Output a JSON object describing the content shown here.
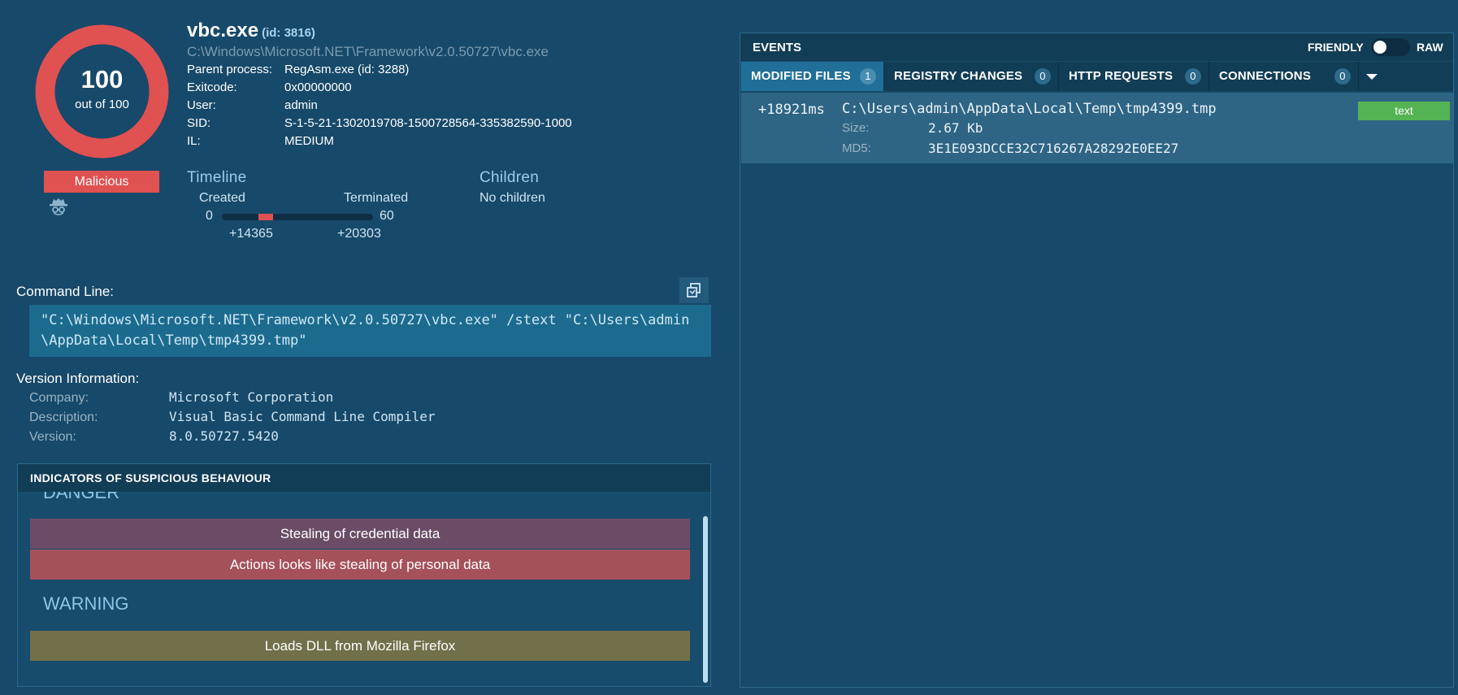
{
  "process": {
    "name": "vbc.exe",
    "id_label": "(id: 3816)",
    "path": "C:\\Windows\\Microsoft.NET\\Framework\\v2.0.50727\\vbc.exe",
    "fields": {
      "parent_label": "Parent process:",
      "parent_value": "RegAsm.exe (id: 3288)",
      "exit_label": "Exitcode:",
      "exit_value": "0x00000000",
      "user_label": "User:",
      "user_value": "admin",
      "sid_label": "SID:",
      "sid_value": "S-1-5-21-1302019708-1500728564-335382590-1000",
      "il_label": "IL:",
      "il_value": "MEDIUM"
    }
  },
  "score": {
    "value": "100",
    "subtitle": "out of 100",
    "fraction": 1.0,
    "verdict": "Malicious",
    "icon": "spy-icon",
    "color": "#e05152"
  },
  "timeline": {
    "title": "Timeline",
    "created_label": "Created",
    "terminated_label": "Terminated",
    "min": "0",
    "max": "60",
    "start": "+14365",
    "end": "+20303",
    "start_seconds": 14.365,
    "end_seconds": 20.303,
    "range_seconds": 60
  },
  "children": {
    "title": "Children",
    "value": "No children"
  },
  "command_line": {
    "label": "Command Line:",
    "text": "\"C:\\Windows\\Microsoft.NET\\Framework\\v2.0.50727\\vbc.exe\" /stext \"C:\\Users\\admin\\AppData\\Local\\Temp\\tmp4399.tmp\"",
    "copy_icon": "copy-icon"
  },
  "version_info": {
    "label": "Version Information:",
    "company_label": "Company:",
    "company_value": "Microsoft Corporation",
    "description_label": "Description:",
    "description_value": "Visual Basic Command Line Compiler",
    "version_label": "Version:",
    "version_value": "8.0.50727.5420"
  },
  "indicators": {
    "header": "INDICATORS OF SUSPICIOUS BEHAVIOUR",
    "danger_label": "DANGER",
    "danger_items": [
      "Stealing of credential data",
      "Actions looks like stealing of personal data"
    ],
    "warning_label": "WARNING",
    "warning_items": [
      "Loads DLL from Mozilla Firefox"
    ]
  },
  "events": {
    "title": "EVENTS",
    "friendly_label": "FRIENDLY",
    "raw_label": "RAW",
    "tabs": [
      {
        "label": "MODIFIED FILES",
        "count": "1"
      },
      {
        "label": "REGISTRY CHANGES",
        "count": "0"
      },
      {
        "label": "HTTP REQUESTS",
        "count": "0"
      },
      {
        "label": "CONNECTIONS",
        "count": "0"
      }
    ],
    "rows": [
      {
        "time": "+18921ms",
        "path": "C:\\Users\\admin\\AppData\\Local\\Temp\\tmp4399.tmp",
        "size_label": "Size:",
        "size_value": "2.67 Kb",
        "md5_label": "MD5:",
        "md5_value": "3E1E093DCCE32C716267A28292E0EE27",
        "type": "text"
      }
    ]
  },
  "colors": {
    "background": "#17496a",
    "danger": "#e05152",
    "credential": "#6a4c67",
    "personal": "#a5515a",
    "warning": "#71704b",
    "badge_text": "#54b453"
  }
}
